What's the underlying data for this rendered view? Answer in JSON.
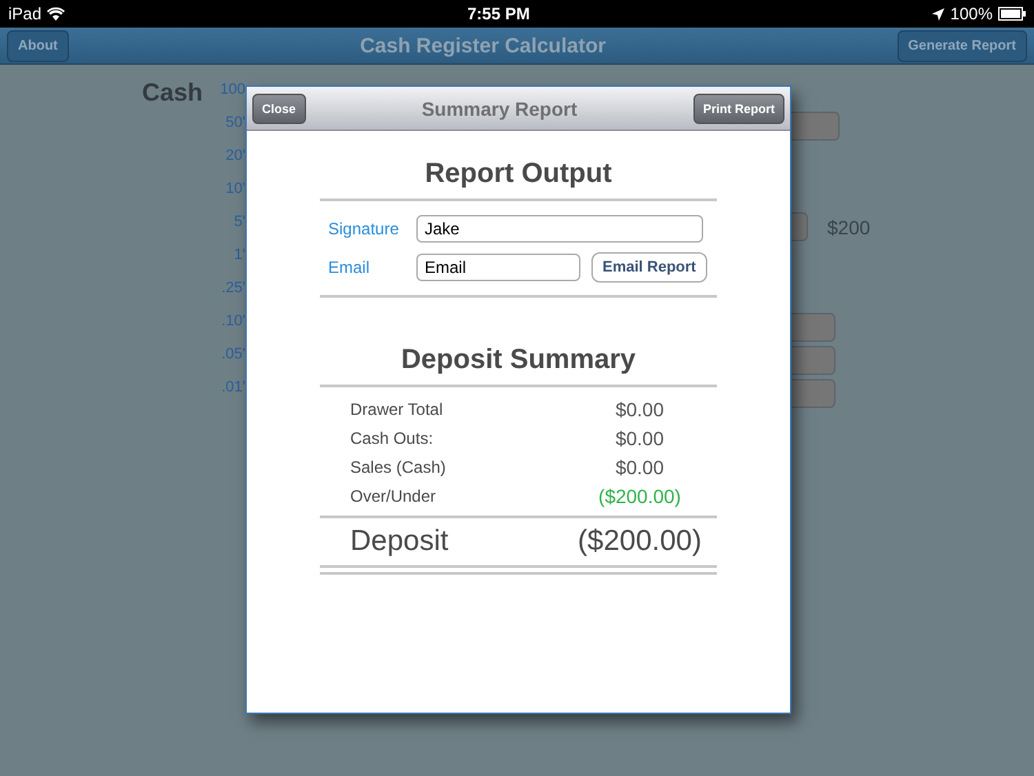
{
  "status_bar": {
    "carrier": "iPad",
    "time": "7:55 PM",
    "battery": "100%"
  },
  "nav_bar": {
    "title": "Cash Register Calculator",
    "left_button": "About",
    "right_button": "Generate Report"
  },
  "background": {
    "heading": "Cash",
    "denominations": [
      "100",
      "50'",
      "20'",
      "10'",
      "5'",
      "1'",
      ".25'",
      ".10'",
      ".05'",
      ".01'"
    ],
    "amount": "$200"
  },
  "modal": {
    "title": "Summary Report",
    "close_button": "Close",
    "print_button": "Print Report",
    "report_output": {
      "heading": "Report Output",
      "signature_label": "Signature",
      "signature_value": "Jake",
      "email_label": "Email",
      "email_placeholder": "Email",
      "email_button": "Email Report"
    },
    "deposit_summary": {
      "heading": "Deposit Summary",
      "rows": [
        {
          "label": "Drawer Total",
          "value": "$0.00",
          "color": "#555555"
        },
        {
          "label": "Cash Outs:",
          "value": "$0.00",
          "color": "#555555"
        },
        {
          "label": "Sales (Cash)",
          "value": "$0.00",
          "color": "#555555"
        },
        {
          "label": "Over/Under",
          "value": "($200.00)",
          "color": "#2fb34a"
        }
      ],
      "total_label": "Deposit",
      "total_value": "($200.00)"
    }
  }
}
